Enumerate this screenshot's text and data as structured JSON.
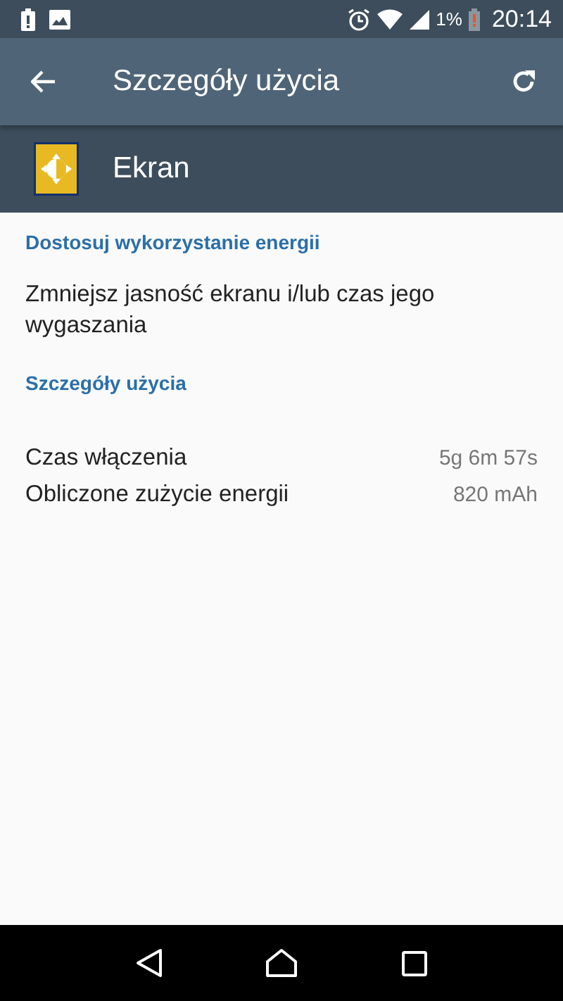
{
  "status_bar": {
    "battery_percent": "1%",
    "time": "20:14"
  },
  "toolbar": {
    "title": "Szczegóły użycia"
  },
  "app": {
    "name": "Ekran"
  },
  "sections": [
    {
      "kind": "suggestion",
      "heading": "Dostosuj wykorzystanie energii",
      "text": "Zmniejsz jasność ekranu i/lub czas jego wygaszania"
    },
    {
      "kind": "details",
      "heading": "Szczegóły użycia",
      "rows": [
        {
          "label": "Czas włączenia",
          "value": "5g 6m 57s"
        },
        {
          "label": "Obliczone zużycie energii",
          "value": "820 mAh"
        }
      ]
    }
  ]
}
